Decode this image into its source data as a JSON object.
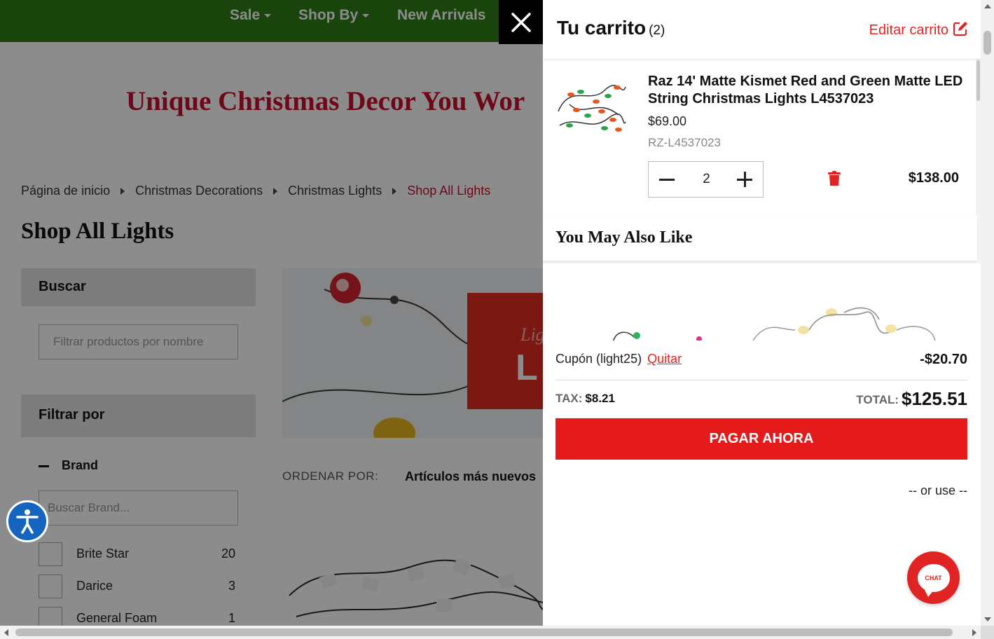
{
  "nav": {
    "items": [
      "Sale",
      "Shop By",
      "New Arrivals"
    ]
  },
  "banner": {
    "text": "Unique Christmas Decor You Wor"
  },
  "breadcrumb": {
    "home": "Página de inicio",
    "level1": "Christmas Decorations",
    "level2": "Christmas Lights",
    "current": "Shop All Lights"
  },
  "page": {
    "title": "Shop All Lights"
  },
  "sidebar": {
    "search_label": "Buscar",
    "search_placeholder": "Filtrar productos por nombre",
    "filter_label": "Filtrar por",
    "brand_label": "Brand",
    "brand_search_placeholder": "Buscar Brand...",
    "brands": [
      {
        "name": "Brite Star",
        "count": "20"
      },
      {
        "name": "Darice",
        "count": "3"
      },
      {
        "name": "General Foam",
        "count": "1"
      }
    ]
  },
  "listing": {
    "sort_label": "ORDENAR POR:",
    "sort_value": "Artículos más nuevos",
    "hero_small": "Ligh",
    "hero_big": "L"
  },
  "cart": {
    "title": "Tu carrito",
    "count": "(2)",
    "edit_label": "Editar carrito",
    "item": {
      "name": "Raz 14' Matte Kismet Red and Green Matte LED String Christmas Lights L4537023",
      "price": "$69.00",
      "sku": "RZ-L4537023",
      "quantity": "2",
      "line_total": "$138.00"
    },
    "also_like_title": "You May Also Like",
    "coupon_label": "Cupón (light25)",
    "coupon_remove": "Quitar",
    "discount": "-$20.70",
    "tax_label": "TAX:",
    "tax_value": "$8.21",
    "total_label": "TOTAL:",
    "total_value": "$125.51",
    "pay_button": "PAGAR AHORA",
    "or_use": "-- or use --"
  },
  "chat": {
    "label": "CHAT"
  },
  "colors": {
    "nav_green": "#2e7d14",
    "brand_red": "#e02424",
    "pay_red": "#e51b1b",
    "accessibility_blue": "#1565c0"
  }
}
